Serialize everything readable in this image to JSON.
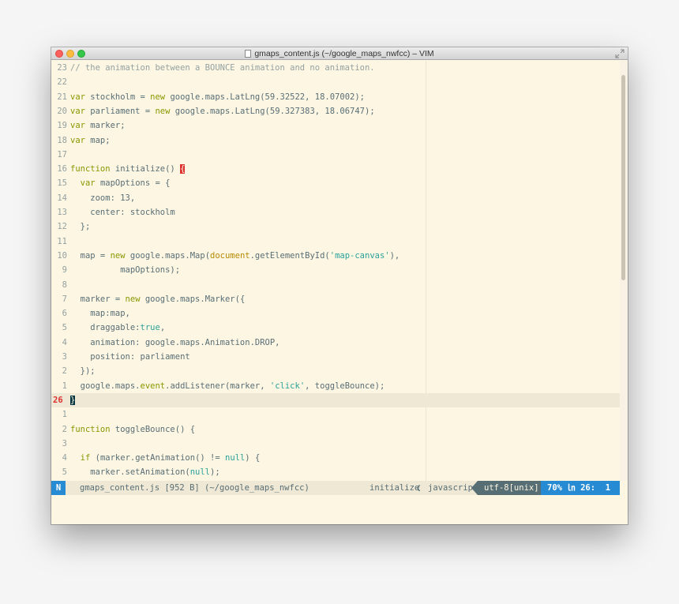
{
  "window": {
    "title": "gmaps_content.js (~/google_maps_nwfcc) – VIM"
  },
  "editor": {
    "lines": [
      {
        "ln": "23",
        "segs": [
          {
            "t": "// the animation between a BOUNCE animation and no animation.",
            "c": "cmt"
          }
        ]
      },
      {
        "ln": "22",
        "segs": []
      },
      {
        "ln": "21",
        "segs": [
          {
            "t": "var",
            "c": "kw"
          },
          {
            "t": " stockholm = "
          },
          {
            "t": "new",
            "c": "kw"
          },
          {
            "t": " google.maps.LatLng(59.32522, 18.07002);"
          }
        ]
      },
      {
        "ln": "20",
        "segs": [
          {
            "t": "var",
            "c": "kw"
          },
          {
            "t": " parliament = "
          },
          {
            "t": "new",
            "c": "kw"
          },
          {
            "t": " google.maps.LatLng(59.327383, 18.06747);"
          }
        ]
      },
      {
        "ln": "19",
        "segs": [
          {
            "t": "var",
            "c": "kw"
          },
          {
            "t": " marker;"
          }
        ]
      },
      {
        "ln": "18",
        "segs": [
          {
            "t": "var",
            "c": "kw"
          },
          {
            "t": " map;"
          }
        ]
      },
      {
        "ln": "17",
        "segs": []
      },
      {
        "ln": "16",
        "segs": [
          {
            "t": "function",
            "c": "kw"
          },
          {
            "t": " initialize() "
          },
          {
            "t": "{",
            "c": "paren-match"
          }
        ]
      },
      {
        "ln": "15",
        "segs": [
          {
            "t": "  "
          },
          {
            "t": "var",
            "c": "kw"
          },
          {
            "t": " mapOptions = {"
          }
        ]
      },
      {
        "ln": "14",
        "segs": [
          {
            "t": "    zoom: 13,"
          }
        ]
      },
      {
        "ln": "13",
        "segs": [
          {
            "t": "    center: stockholm"
          }
        ]
      },
      {
        "ln": "12",
        "segs": [
          {
            "t": "  };"
          }
        ]
      },
      {
        "ln": "11",
        "segs": []
      },
      {
        "ln": "10",
        "segs": [
          {
            "t": "  map = "
          },
          {
            "t": "new",
            "c": "kw"
          },
          {
            "t": " google.maps.Map("
          },
          {
            "t": "document",
            "c": "bi"
          },
          {
            "t": ".getElementById("
          },
          {
            "t": "'map-canvas'",
            "c": "str"
          },
          {
            "t": "),"
          }
        ]
      },
      {
        "ln": "9",
        "segs": [
          {
            "t": "          mapOptions);"
          }
        ]
      },
      {
        "ln": "8",
        "segs": []
      },
      {
        "ln": "7",
        "segs": [
          {
            "t": "  marker = "
          },
          {
            "t": "new",
            "c": "kw"
          },
          {
            "t": " google.maps.Marker({"
          }
        ]
      },
      {
        "ln": "6",
        "segs": [
          {
            "t": "    map:map,"
          }
        ]
      },
      {
        "ln": "5",
        "segs": [
          {
            "t": "    draggable:"
          },
          {
            "t": "true",
            "c": "str"
          },
          {
            "t": ","
          }
        ]
      },
      {
        "ln": "4",
        "segs": [
          {
            "t": "    animation: google.maps.Animation.DROP,"
          }
        ]
      },
      {
        "ln": "3",
        "segs": [
          {
            "t": "    position: parliament"
          }
        ]
      },
      {
        "ln": "2",
        "segs": [
          {
            "t": "  });"
          }
        ]
      },
      {
        "ln": "1",
        "segs": [
          {
            "t": "  google.maps."
          },
          {
            "t": "event",
            "c": "kw"
          },
          {
            "t": ".addListener(marker, "
          },
          {
            "t": "'click'",
            "c": "str"
          },
          {
            "t": ", toggleBounce);"
          }
        ]
      },
      {
        "ln": "26",
        "cursor": true,
        "segs": [
          {
            "t": "}",
            "c": "cursor-block"
          }
        ]
      },
      {
        "ln": "1",
        "segs": []
      },
      {
        "ln": "2",
        "segs": [
          {
            "t": "function",
            "c": "kw"
          },
          {
            "t": " toggleBounce() {"
          }
        ]
      },
      {
        "ln": "3",
        "segs": []
      },
      {
        "ln": "4",
        "segs": [
          {
            "t": "  "
          },
          {
            "t": "if",
            "c": "kw"
          },
          {
            "t": " (marker.getAnimation() != "
          },
          {
            "t": "null",
            "c": "str"
          },
          {
            "t": ") {"
          }
        ]
      },
      {
        "ln": "5",
        "segs": [
          {
            "t": "    marker.setAnimation("
          },
          {
            "t": "null",
            "c": "str"
          },
          {
            "t": ");"
          }
        ]
      }
    ]
  },
  "statusline": {
    "mode": "N",
    "file": "gmaps_content.js [952 B] (~/google_maps_nwfcc)",
    "function": "initialize",
    "separator": "❮",
    "filetype": "javascript",
    "encoding": "utf-8[unix]",
    "position": "70% ㏑ 26:  1"
  },
  "colors": {
    "background": "#fdf6e3",
    "keyword": "#859900",
    "string": "#2aa198",
    "comment": "#93a1a1",
    "accent": "#268bd2"
  }
}
